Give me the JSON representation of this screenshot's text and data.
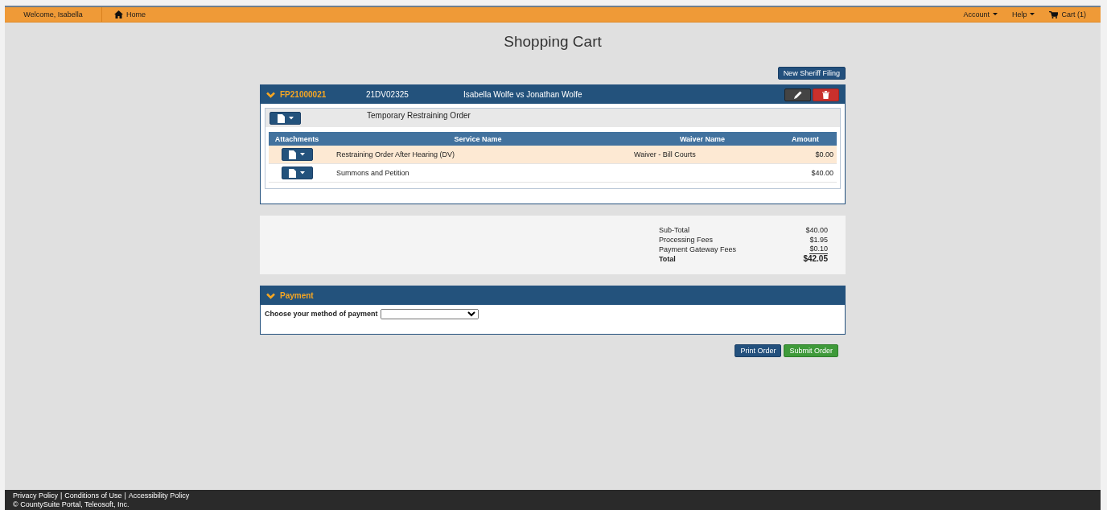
{
  "top_bar": {
    "welcome": "Welcome, Isabella",
    "home": "Home",
    "menus": [
      {
        "label": "Account",
        "kind": "dropdown"
      },
      {
        "label": "Help",
        "kind": "dropdown"
      },
      {
        "label": "Cart (1)",
        "kind": "cart"
      }
    ]
  },
  "page_title": "Shopping Cart",
  "new_filing_button": "New Sheriff Filing",
  "filing": {
    "id": "FP21000021",
    "case_number": "21DV02325",
    "case_title": "Isabella Wolfe vs Jonathan Wolfe",
    "expanded": true,
    "document": "Temporary Restraining Order",
    "columns": [
      "Attachments",
      "Service Name",
      "Waiver Name",
      "Amount"
    ],
    "rows": [
      {
        "service": "Restraining Order After Hearing (DV)",
        "waiver": "Waiver - Bill Courts",
        "amount": "$0.00",
        "waived": true
      },
      {
        "service": "Summons and Petition",
        "amount": "$40.00",
        "waived": false
      }
    ]
  },
  "totals": [
    {
      "label": "Sub-Total",
      "value": "$40.00",
      "kind": "line"
    },
    {
      "label": "Processing Fees",
      "value": "$1.95",
      "kind": "line"
    },
    {
      "label": "Payment Gateway Fees",
      "value": "$0.10",
      "kind": "last"
    },
    {
      "label": "Total",
      "value": "$42.05",
      "kind": "total"
    }
  ],
  "payment": {
    "title": "Payment",
    "expanded": true,
    "label": "Choose your method of payment"
  },
  "buttons": [
    {
      "label": "Print Order",
      "kind": "primary"
    },
    {
      "label": "Submit Order",
      "kind": "success"
    }
  ],
  "footer": {
    "links": [
      "Privacy Policy",
      "Conditions of Use",
      "Accessibility Policy"
    ],
    "separator": "|",
    "copyright": "© CountySuite Portal, Teleosoft, Inc."
  }
}
